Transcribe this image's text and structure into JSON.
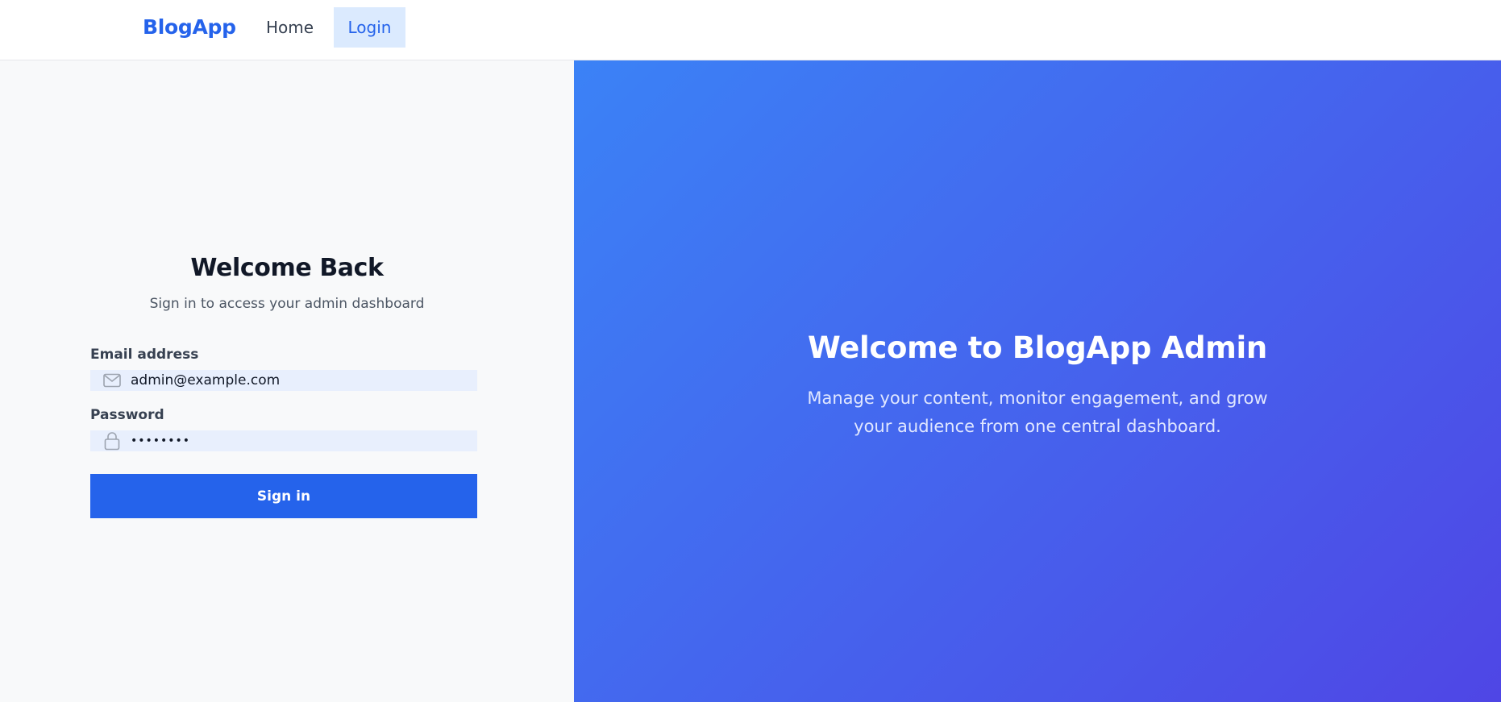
{
  "navbar": {
    "brand": "BlogApp",
    "links": [
      {
        "label": "Home",
        "active": false
      },
      {
        "label": "Login",
        "active": true
      }
    ]
  },
  "login": {
    "title": "Welcome Back",
    "subtitle": "Sign in to access your admin dashboard",
    "email": {
      "label": "Email address",
      "value": "admin@example.com",
      "icon": "mail-icon"
    },
    "password": {
      "label": "Password",
      "value": "password",
      "icon": "lock-icon"
    },
    "submit_label": "Sign in"
  },
  "hero": {
    "title": "Welcome to BlogApp Admin",
    "text": "Manage your content, monitor engagement, and grow your audience from one central dashboard."
  },
  "colors": {
    "accent": "#2563eb",
    "active_nav_bg": "#dbeafe",
    "field_bg": "#e8effd",
    "gradient_start": "#3b82f6",
    "gradient_end": "#4f46e5"
  }
}
